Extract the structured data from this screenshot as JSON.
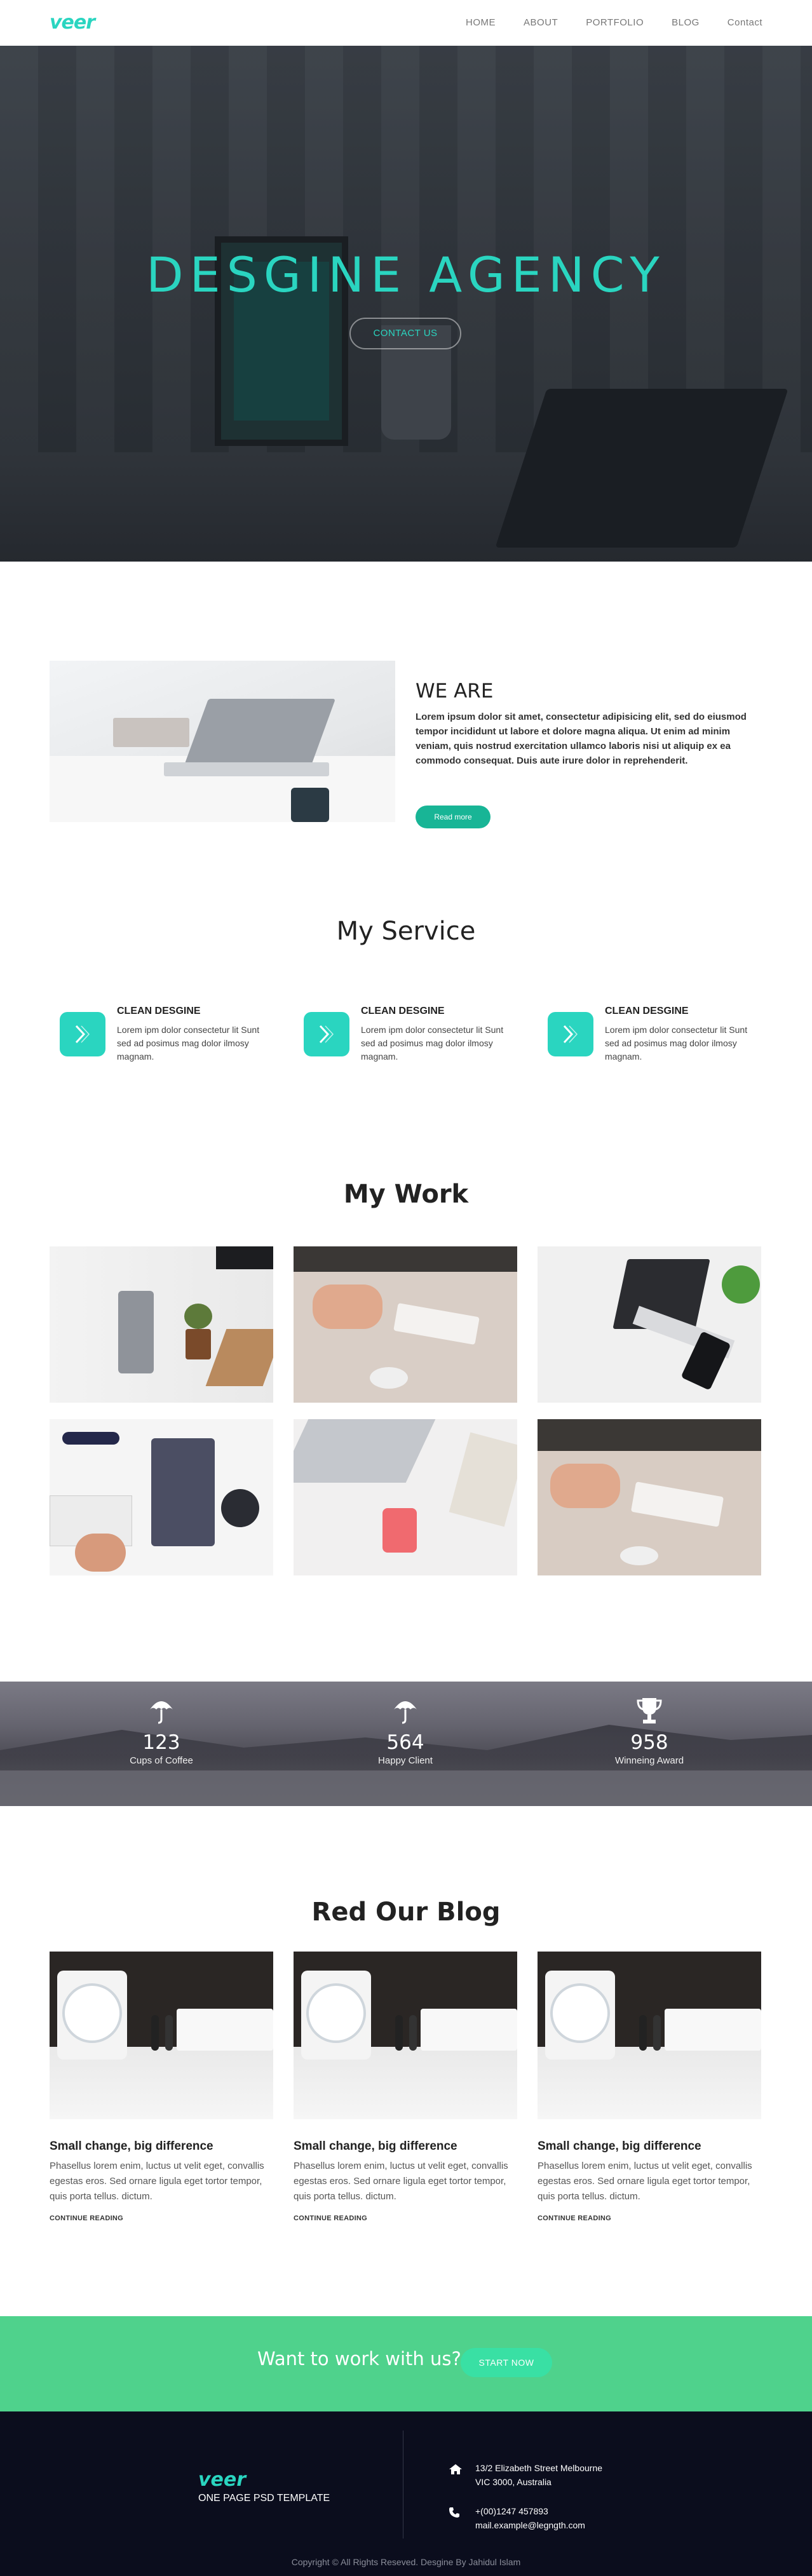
{
  "brand": {
    "logo": "veer",
    "accent": "#2ad5c0"
  },
  "nav": {
    "items": [
      "HOME",
      "ABOUT",
      "PORTFOLIO",
      "BLOG",
      "Contact"
    ]
  },
  "hero": {
    "title": "DESGINE AGENCY",
    "button": "CONTACT US"
  },
  "about": {
    "title": "WE ARE",
    "text": "Lorem ipsum dolor sit amet, consectetur adipisicing elit, sed do eiusmod tempor incididunt ut labore et dolore magna aliqua. Ut enim ad minim veniam, quis nostrud exercitation ullamco laboris nisi ut aliquip ex ea commodo consequat. Duis aute irure dolor in reprehenderit.",
    "button": "Read more"
  },
  "services": {
    "title": "My Service",
    "items": [
      {
        "name": "CLEAN DESGINE",
        "desc": "Lorem ipm dolor consectetur lit Sunt sed ad posimus mag dolor ilmosy magnam."
      },
      {
        "name": "CLEAN DESGINE",
        "desc": "Lorem ipm dolor consectetur lit Sunt sed ad posimus mag dolor ilmosy magnam."
      },
      {
        "name": "CLEAN DESGINE",
        "desc": "Lorem ipm dolor consectetur lit Sunt sed ad posimus mag dolor ilmosy magnam."
      }
    ],
    "icon": "chevron-logo-icon"
  },
  "work": {
    "title": "My Work"
  },
  "stats": {
    "items": [
      {
        "icon": "umbrella-icon",
        "value": "123",
        "label": "Cups of Coffee"
      },
      {
        "icon": "umbrella-icon",
        "value": "564",
        "label": "Happy Client"
      },
      {
        "icon": "trophy-icon",
        "value": "958",
        "label": "Winneing Award"
      }
    ]
  },
  "blog": {
    "title": "Red Our Blog",
    "posts": [
      {
        "title": "Small change, big difference",
        "excerpt": "Phasellus lorem enim, luctus ut velit eget, convallis egestas eros. Sed ornare ligula eget tortor tempor, quis porta tellus. dictum.",
        "link": "CONTINUE READING"
      },
      {
        "title": "Small change, big difference",
        "excerpt": "Phasellus lorem enim, luctus ut velit eget, convallis egestas eros. Sed ornare ligula eget tortor tempor, quis porta tellus. dictum.",
        "link": "CONTINUE READING"
      },
      {
        "title": "Small change, big difference",
        "excerpt": "Phasellus lorem enim, luctus ut velit eget, convallis egestas eros. Sed ornare ligula eget tortor tempor, quis porta tellus. dictum.",
        "link": "CONTINUE READING"
      }
    ]
  },
  "cta": {
    "text": "Want to work with us?",
    "button": "START NOW",
    "color": "#4fd28c"
  },
  "footer": {
    "logo": "veer",
    "subtitle": "ONE PAGE PSD TEMPLATE",
    "address_line1": "13/2 Elizabeth Street Melbourne",
    "address_line2": "VIC 3000, Australia",
    "phone": "+(00)1247 457893",
    "email": "mail.example@legngth.com",
    "copyright": "Copyright © All Rights Reseved. Desgine By Jahidul Islam"
  }
}
